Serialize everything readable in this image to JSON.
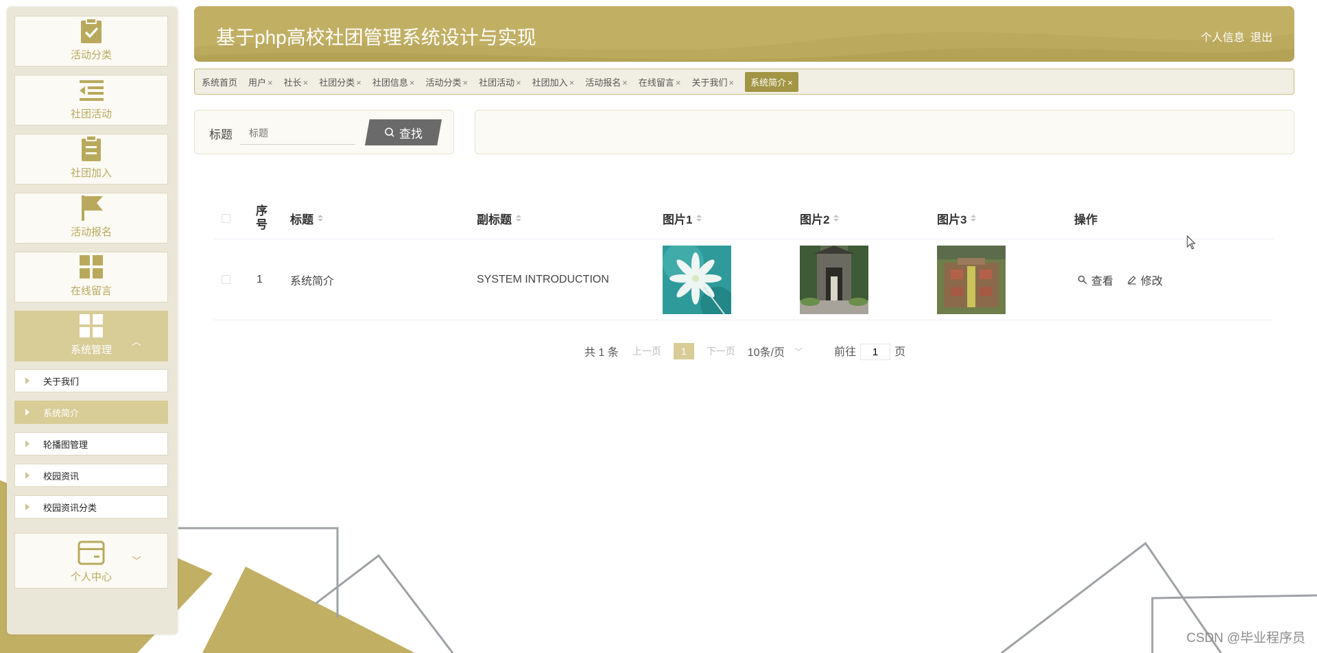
{
  "header": {
    "title": "基于php高校社团管理系统设计与实现",
    "user_info": "个人信息",
    "logout": "退出"
  },
  "sidebar": {
    "menu": [
      {
        "label": "活动分类",
        "icon": "clipboard-check-icon"
      },
      {
        "label": "社团活动",
        "icon": "list-indent-icon"
      },
      {
        "label": "社团加入",
        "icon": "clipboard-icon"
      },
      {
        "label": "活动报名",
        "icon": "flag-icon"
      },
      {
        "label": "在线留言",
        "icon": "grid-icon"
      }
    ],
    "system_menu": {
      "label": "系统管理",
      "icon": "grid-icon",
      "chevron": "chevron-up-icon"
    },
    "sub_items": [
      {
        "label": "关于我们"
      },
      {
        "label": "系统简介"
      },
      {
        "label": "轮播图管理"
      },
      {
        "label": "校园资讯"
      },
      {
        "label": "校园资讯分类"
      }
    ],
    "personal_menu": {
      "label": "个人中心",
      "icon": "wallet-icon",
      "chevron": "chevron-down-icon"
    }
  },
  "tabs": [
    {
      "label": "系统首页",
      "closable": false
    },
    {
      "label": "用户",
      "closable": true
    },
    {
      "label": "社长",
      "closable": true
    },
    {
      "label": "社团分类",
      "closable": true
    },
    {
      "label": "社团信息",
      "closable": true
    },
    {
      "label": "活动分类",
      "closable": true
    },
    {
      "label": "社团活动",
      "closable": true
    },
    {
      "label": "社团加入",
      "closable": true
    },
    {
      "label": "活动报名",
      "closable": true
    },
    {
      "label": "在线留言",
      "closable": true
    },
    {
      "label": "关于我们",
      "closable": true
    },
    {
      "label": "系统简介",
      "closable": true,
      "active": true
    }
  ],
  "tab_close": "×",
  "search": {
    "label": "标题",
    "placeholder": "标题",
    "button": "查找"
  },
  "table": {
    "columns": {
      "index": "序号",
      "title": "标题",
      "subtitle": "副标题",
      "pic1": "图片1",
      "pic2": "图片2",
      "pic3": "图片3",
      "actions": "操作"
    },
    "rows": [
      {
        "index": "1",
        "title": "系统简介",
        "subtitle": "SYSTEM INTRODUCTION",
        "view": "查看",
        "edit": "修改"
      }
    ]
  },
  "pagination": {
    "total": "共 1 条",
    "prev": "上一页",
    "current": "1",
    "next": "下一页",
    "page_size": "10条/页",
    "goto_prefix": "前往",
    "goto_value": "1",
    "goto_suffix": "页"
  },
  "watermark": "CSDN @毕业程序员",
  "colors": {
    "accent": "#c1af64",
    "accent_light": "#d8cc97",
    "active_tab": "#a29543",
    "sidebar_bg": "#ebe7d8"
  }
}
